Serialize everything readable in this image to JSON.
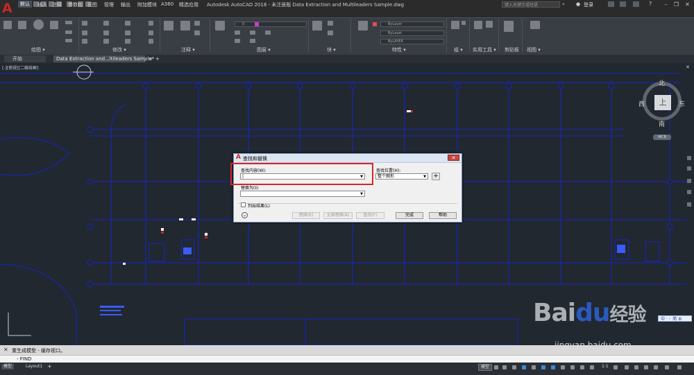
{
  "app": {
    "title": "Autodesk AutoCAD 2018 - 未注册版    Data Extraction and Multileaders Sample.dwg",
    "search_placeholder": "键入关键字或短语",
    "login_label": "登录",
    "logo_letter": "A"
  },
  "menu": {
    "items": [
      "默认",
      "插入",
      "注释",
      "参数化",
      "视图",
      "管理",
      "输出",
      "附加模块",
      "A360",
      "精选应用"
    ],
    "active_index": 0
  },
  "ribbon": {
    "panels": [
      "绘图 ▾",
      "修改 ▾",
      "注释 ▾",
      "图层 ▾",
      "块 ▾",
      "特性 ▾",
      "组 ▾",
      "实用工具 ▾",
      "剪贴板",
      "视图 ▾"
    ],
    "layer_value": "0",
    "prop_bylayer": [
      "ByLayer",
      "ByLayer",
      "ByLAYER"
    ]
  },
  "doc_tabs": {
    "start_label": "开始",
    "file_label": "Data Extraction and...ltileaders Sample*",
    "close_icon": "×",
    "add_icon": "+"
  },
  "viewport": {
    "label": "[-][俯视][二维线框]"
  },
  "viewcube": {
    "north": "北",
    "south": "南",
    "west": "西",
    "east": "东",
    "top_face": "上",
    "wcs_label": "WCB"
  },
  "dialog": {
    "title": "查找和替换",
    "find_label": "查找内容(W):",
    "find_value": "|",
    "replace_label": "替换为(I):",
    "replace_value": "",
    "search_in_label": "查找位置(H):",
    "search_in_value": "整个图形",
    "list_results_label": "列出结果(L)",
    "buttons": {
      "replace": "替换(R)",
      "replace_all": "全部替换(A)",
      "find": "查找(F)",
      "done": "完成",
      "help": "帮助"
    }
  },
  "command": {
    "history": "重生成模型 - 缓存视口。",
    "prompt": "- FIND"
  },
  "status": {
    "model_tab": "模型",
    "layout_tab": "Layout1",
    "model_btn": "模型",
    "scale": "1:1"
  },
  "watermark": {
    "brand_bai": "Bai",
    "brand_du": "du",
    "brand_jingyan": "经验",
    "url": "jingyan.baidu.com",
    "ime": "中 · ◦ 简 ⚙"
  }
}
